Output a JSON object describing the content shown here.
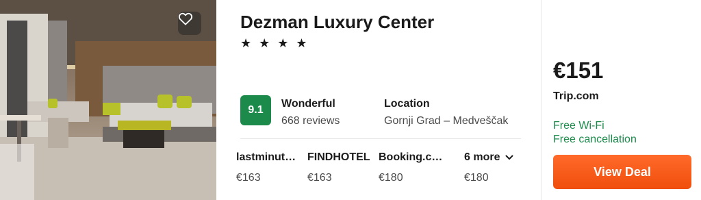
{
  "hotel": {
    "name": "Dezman Luxury Center",
    "stars": "★ ★ ★ ★",
    "star_count": 4
  },
  "rating": {
    "score": "9.1",
    "label": "Wonderful",
    "reviews": "668 reviews",
    "badge_color": "#1b8a4b"
  },
  "location": {
    "label": "Location",
    "value": "Gornji Grad – Medveščak"
  },
  "deals": [
    {
      "provider": "lastminut…",
      "price": "€163"
    },
    {
      "provider": "FINDHOTEL",
      "price": "€163"
    },
    {
      "provider": "Booking.c…",
      "price": "€180"
    },
    {
      "provider": "6 more",
      "price": "€180"
    }
  ],
  "best_deal": {
    "price": "€151",
    "provider": "Trip.com",
    "amenities": [
      "Free Wi-Fi",
      "Free cancellation"
    ],
    "button_label": "View Deal",
    "button_color": "#f25a14",
    "amenity_color": "#1b8a4b"
  },
  "icons": {
    "favorite": "heart-icon",
    "expand": "chevron-down-icon"
  }
}
